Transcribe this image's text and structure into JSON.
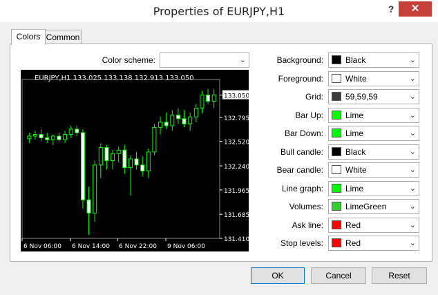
{
  "window": {
    "title": "Properties of EURJPY,H1",
    "help": "?",
    "close": "✕"
  },
  "tabs": [
    {
      "label": "Colors"
    },
    {
      "label": "Common"
    }
  ],
  "scheme": {
    "label": "Color scheme:",
    "value": ""
  },
  "props": [
    {
      "label": "Background:",
      "value": "Black",
      "color": "#000000"
    },
    {
      "label": "Foreground:",
      "value": "White",
      "color": "#ffffff"
    },
    {
      "label": "Grid:",
      "value": "59,59,59",
      "color": "#3b3b3b"
    },
    {
      "label": "Bar Up:",
      "value": "Lime",
      "color": "#00ff00"
    },
    {
      "label": "Bar Down:",
      "value": "Lime",
      "color": "#00ff00"
    },
    {
      "label": "Bull candle:",
      "value": "Black",
      "color": "#000000"
    },
    {
      "label": "Bear candle:",
      "value": "White",
      "color": "#ffffff"
    },
    {
      "label": "Line graph:",
      "value": "Lime",
      "color": "#00ff00"
    },
    {
      "label": "Volumes:",
      "value": "LimeGreen",
      "color": "#32cd32"
    },
    {
      "label": "Ask line:",
      "value": "Red",
      "color": "#ff0000"
    },
    {
      "label": "Stop levels:",
      "value": "Red",
      "color": "#ff0000"
    }
  ],
  "buttons": {
    "ok": "OK",
    "cancel": "Cancel",
    "reset": "Reset"
  },
  "chart": {
    "header": "EURJPY,H1  133.025 133.138 132.913 133.050",
    "price_labels": [
      "133.050",
      "132.795",
      "132.520",
      "132.240",
      "131.965",
      "131.685",
      "131.410"
    ],
    "time_labels": [
      "6 Nov 06:00",
      "6 Nov 14:00",
      "6 Nov 22:00",
      "9 Nov 06:00"
    ]
  },
  "chart_data": {
    "type": "candlestick",
    "symbol": "EURJPY,H1",
    "ylim": [
      131.41,
      133.15
    ],
    "x_ticks": [
      "6 Nov 06:00",
      "6 Nov 14:00",
      "6 Nov 22:00",
      "9 Nov 06:00"
    ],
    "candles": [
      {
        "o": 132.55,
        "h": 132.62,
        "l": 132.5,
        "c": 132.58
      },
      {
        "o": 132.58,
        "h": 132.64,
        "l": 132.54,
        "c": 132.6
      },
      {
        "o": 132.6,
        "h": 132.66,
        "l": 132.52,
        "c": 132.56
      },
      {
        "o": 132.56,
        "h": 132.62,
        "l": 132.5,
        "c": 132.54
      },
      {
        "o": 132.54,
        "h": 132.6,
        "l": 132.48,
        "c": 132.58
      },
      {
        "o": 132.58,
        "h": 132.62,
        "l": 132.52,
        "c": 132.54
      },
      {
        "o": 132.54,
        "h": 132.64,
        "l": 132.5,
        "c": 132.6
      },
      {
        "o": 132.6,
        "h": 132.7,
        "l": 132.56,
        "c": 132.66
      },
      {
        "o": 132.66,
        "h": 132.7,
        "l": 132.58,
        "c": 132.62
      },
      {
        "o": 132.62,
        "h": 132.66,
        "l": 131.75,
        "c": 131.85
      },
      {
        "o": 131.85,
        "h": 132.0,
        "l": 131.45,
        "c": 131.7
      },
      {
        "o": 131.7,
        "h": 132.3,
        "l": 131.6,
        "c": 132.25
      },
      {
        "o": 132.25,
        "h": 132.5,
        "l": 132.1,
        "c": 132.45
      },
      {
        "o": 132.45,
        "h": 132.48,
        "l": 132.2,
        "c": 132.3
      },
      {
        "o": 132.3,
        "h": 132.42,
        "l": 132.2,
        "c": 132.38
      },
      {
        "o": 132.38,
        "h": 132.46,
        "l": 132.28,
        "c": 132.42
      },
      {
        "o": 132.42,
        "h": 132.48,
        "l": 132.15,
        "c": 132.22
      },
      {
        "o": 132.22,
        "h": 132.36,
        "l": 131.9,
        "c": 132.32
      },
      {
        "o": 132.32,
        "h": 132.4,
        "l": 132.2,
        "c": 132.25
      },
      {
        "o": 132.25,
        "h": 132.35,
        "l": 132.12,
        "c": 132.18
      },
      {
        "o": 132.18,
        "h": 132.44,
        "l": 132.1,
        "c": 132.4
      },
      {
        "o": 132.4,
        "h": 132.72,
        "l": 132.36,
        "c": 132.68
      },
      {
        "o": 132.68,
        "h": 132.8,
        "l": 132.6,
        "c": 132.74
      },
      {
        "o": 132.74,
        "h": 132.85,
        "l": 132.66,
        "c": 132.7
      },
      {
        "o": 132.7,
        "h": 132.88,
        "l": 132.64,
        "c": 132.82
      },
      {
        "o": 132.82,
        "h": 132.9,
        "l": 132.72,
        "c": 132.78
      },
      {
        "o": 132.78,
        "h": 132.88,
        "l": 132.68,
        "c": 132.72
      },
      {
        "o": 132.72,
        "h": 132.85,
        "l": 132.64,
        "c": 132.8
      },
      {
        "o": 132.8,
        "h": 132.95,
        "l": 132.74,
        "c": 132.9
      },
      {
        "o": 132.9,
        "h": 133.1,
        "l": 132.84,
        "c": 133.05
      },
      {
        "o": 133.05,
        "h": 133.12,
        "l": 132.95,
        "c": 132.98
      },
      {
        "o": 132.98,
        "h": 133.12,
        "l": 132.9,
        "c": 133.05
      }
    ]
  }
}
